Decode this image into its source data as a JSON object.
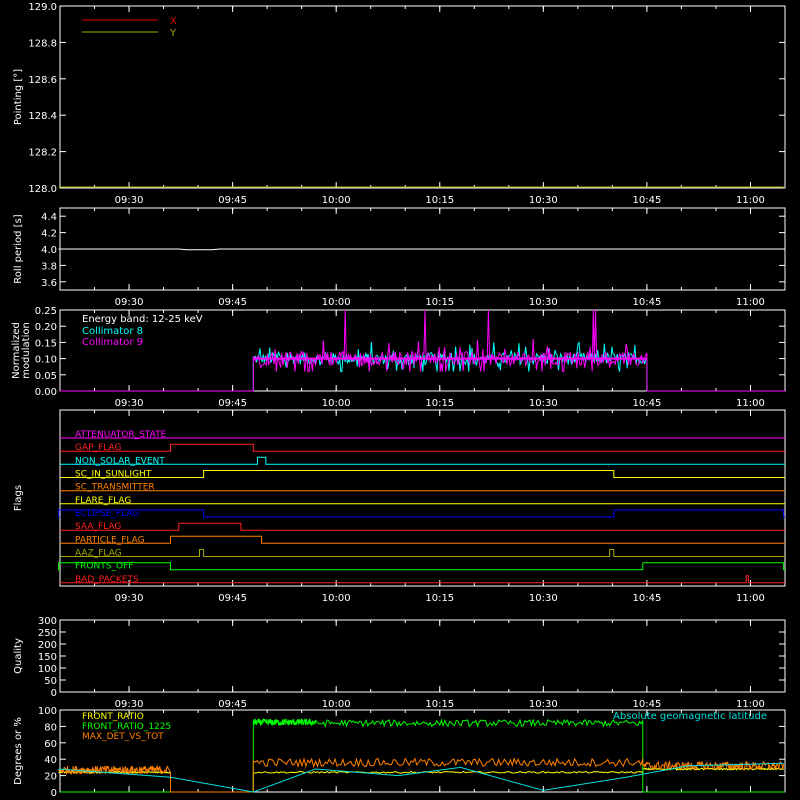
{
  "chart_data": [
    {
      "type": "line",
      "ylabel": "Pointing [°]",
      "ylim": [
        128.0,
        129.0
      ],
      "yticks": [
        "128.0",
        "128.2",
        "128.4",
        "128.6",
        "128.8",
        "129.0"
      ],
      "legend_position": "top-left",
      "series": [
        {
          "name": "X",
          "color": "#e00000",
          "values": []
        },
        {
          "name": "Y",
          "color": "#a8a800",
          "values": [
            [
              9.33,
              128.0
            ],
            [
              11.08,
              128.0
            ]
          ]
        }
      ]
    },
    {
      "type": "line",
      "ylabel": "Roll period [s]",
      "ylim": [
        3.5,
        4.5
      ],
      "yticks": [
        "3.6",
        "3.8",
        "4.0",
        "4.2",
        "4.4"
      ],
      "series": [
        {
          "color": "#ffffff",
          "values": [
            [
              9.33,
              4.0
            ],
            [
              9.62,
              4.0
            ],
            [
              9.64,
              3.99
            ],
            [
              9.7,
              3.99
            ],
            [
              9.72,
              4.0
            ],
            [
              11.08,
              4.0
            ]
          ]
        }
      ]
    },
    {
      "type": "line",
      "ylabel": "Normalized modulation",
      "ylim": [
        0.0,
        0.25
      ],
      "yticks": [
        "0.00",
        "0.05",
        "0.10",
        "0.15",
        "0.20",
        "0.25"
      ],
      "annotation": "Energy band: 12-25 keV",
      "legend_position": "top-left",
      "series": [
        {
          "name": "Collimator 8",
          "color": "#00ffff",
          "start": 9.8,
          "end": 10.75,
          "base": 0.1,
          "noise": 0.03
        },
        {
          "name": "Collimator 9",
          "color": "#ff00ff",
          "start": 9.8,
          "end": 10.75,
          "base": 0.1,
          "noise": 0.035
        }
      ]
    },
    {
      "type": "line",
      "ylabel": "Flags",
      "flags": [
        {
          "name": "ATTENUATOR_STATE",
          "color": "#ff00ff",
          "highs": []
        },
        {
          "name": "GAP_FLAG",
          "color": "#ff2020",
          "highs": [
            [
              9.6,
              9.8
            ]
          ]
        },
        {
          "name": "NON_SOLAR_EVENT",
          "color": "#00ffff",
          "highs": [
            [
              9.81,
              9.83
            ]
          ]
        },
        {
          "name": "SC_IN_SUNLIGHT",
          "color": "#ffff00",
          "highs": [
            [
              9.68,
              10.67
            ]
          ]
        },
        {
          "name": "SC_TRANSMITTER",
          "color": "#ff8000",
          "highs": []
        },
        {
          "name": "FLARE_FLAG",
          "color": "#ffff00",
          "highs": []
        },
        {
          "name": "ECLIPSE_FLAG",
          "color": "#0000ff",
          "highs": [
            [
              9.33,
              9.68
            ],
            [
              10.67,
              11.08
            ]
          ]
        },
        {
          "name": "SAA_FLAG",
          "color": "#ff2020",
          "highs": [
            [
              9.62,
              9.77
            ]
          ]
        },
        {
          "name": "PARTICLE_FLAG",
          "color": "#ff8000",
          "highs": [
            [
              9.6,
              9.82
            ]
          ]
        },
        {
          "name": "AAZ_FLAG",
          "color": "#a8a800",
          "highs": [
            [
              9.67,
              9.68
            ],
            [
              10.66,
              10.67
            ]
          ]
        },
        {
          "name": "FRONTS_OFF",
          "color": "#00ff00",
          "highs": [
            [
              9.33,
              9.6
            ],
            [
              10.74,
              11.08
            ]
          ]
        },
        {
          "name": "BAD_PACKETS",
          "color": "#ff2020",
          "highs": [
            [
              10.99,
              10.995
            ]
          ]
        }
      ]
    },
    {
      "type": "line",
      "ylabel": "Quality",
      "ylim": [
        0,
        300
      ],
      "yticks": [
        "0",
        "50",
        "100",
        "150",
        "200",
        "250",
        "300"
      ],
      "series": []
    },
    {
      "type": "line",
      "ylabel": "Degrees or %",
      "ylim": [
        0,
        100
      ],
      "yticks": [
        "0",
        "20",
        "40",
        "60",
        "80",
        "100"
      ],
      "annotation": "Absolute geomagnetic latitude",
      "legend_position": "top-left",
      "series": [
        {
          "name": "FRONT_RATIO",
          "color": "#ffff00",
          "segments": [
            [
              9.33,
              9.6,
              24
            ],
            [
              9.8,
              10.74,
              24
            ],
            [
              10.74,
              11.08,
              28
            ]
          ]
        },
        {
          "name": "FRONT_RATIO_1225",
          "color": "#00ff00",
          "segments": [
            [
              9.8,
              9.95,
              85
            ],
            [
              9.95,
              10.74,
              84
            ]
          ]
        },
        {
          "name": "MAX_DET_VS_TOT",
          "color": "#ff8000",
          "segments": [
            [
              9.33,
              9.6,
              27
            ],
            [
              9.8,
              10.74,
              36
            ],
            [
              10.74,
              11.08,
              32
            ]
          ]
        },
        {
          "name": "geomag",
          "color": "#00e0e0",
          "values": [
            [
              9.33,
              28
            ],
            [
              9.6,
              18
            ],
            [
              9.8,
              0
            ],
            [
              9.95,
              28
            ],
            [
              10.15,
              20
            ],
            [
              10.3,
              30
            ],
            [
              10.5,
              2
            ],
            [
              10.7,
              18
            ],
            [
              10.85,
              32
            ],
            [
              11.08,
              35
            ]
          ]
        }
      ]
    }
  ],
  "xaxis": {
    "range": [
      "09:20",
      "11:05"
    ],
    "ticks": [
      "09:30",
      "09:45",
      "10:00",
      "10:15",
      "10:30",
      "10:45",
      "11:00"
    ]
  }
}
